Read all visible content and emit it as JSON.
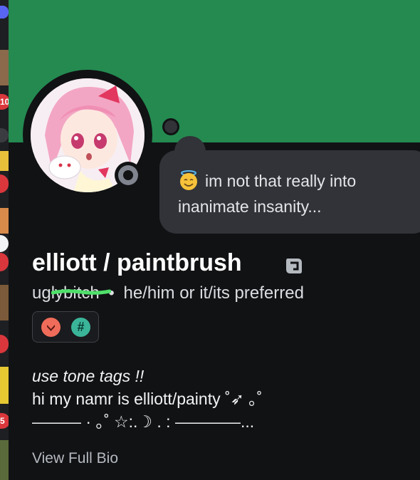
{
  "colors": {
    "banner": "#248a50",
    "background": "#111214",
    "status_bubble": "#313338",
    "offline_status": "#80848e",
    "strike_highlight": "#4fe06a",
    "badge_orange": "#f06c5a",
    "badge_teal": "#3bb59a"
  },
  "server_strip": {
    "badges": [
      "10",
      "",
      "",
      "",
      "",
      "5"
    ]
  },
  "avatar": {
    "description_icon": "anime-girl-avatar",
    "status": "offline"
  },
  "custom_status": {
    "emoji": "smiling-face-with-halo",
    "text": "im not that really into inanimate insanity..."
  },
  "profile": {
    "display_name": "elliott / paintbrush",
    "nitro_icon": "nitro-icon",
    "username": "uglybitch",
    "separator": "•",
    "pronouns": "he/him or it/its preferred"
  },
  "badges": [
    {
      "icon": "hypesquad-icon",
      "color": "#f06c5a"
    },
    {
      "icon": "hashtag-icon",
      "glyph": "#",
      "color": "#3bb59a"
    }
  ],
  "bio": {
    "line1": "use tone tags !!",
    "line2": "hi my namr is elliott/painty ˚➶ ｡˚",
    "line3": "——— · ｡˚ ☆:.☽ . : ————..."
  },
  "view_full_bio": "View Full Bio"
}
